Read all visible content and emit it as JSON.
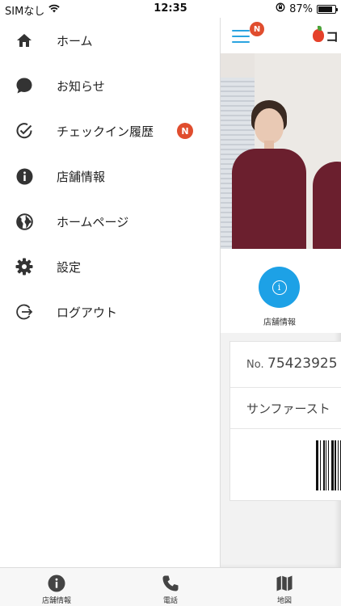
{
  "status_bar": {
    "carrier": "SIMなし",
    "time": "12:35",
    "battery": "87%",
    "battery_level": 0.87
  },
  "drawer": {
    "items": [
      {
        "label": "ホーム",
        "icon": "home-icon"
      },
      {
        "label": "お知らせ",
        "icon": "chat-bubble-icon"
      },
      {
        "label": "チェックイン履歴",
        "icon": "check-circle-icon",
        "badge": "N"
      },
      {
        "label": "店舗情報",
        "icon": "info-icon"
      },
      {
        "label": "ホームページ",
        "icon": "globe-icon"
      },
      {
        "label": "設定",
        "icon": "gear-icon"
      },
      {
        "label": "ログアウト",
        "icon": "logout-icon"
      }
    ]
  },
  "header": {
    "badge": "N",
    "logo_text": "コ"
  },
  "quick_actions": [
    {
      "label": "店舗情報",
      "icon": "info-icon"
    }
  ],
  "member_card": {
    "number_prefix": "No.",
    "number": "75423925",
    "name": "サンファースト"
  },
  "tabbar": [
    {
      "label": "店舗情報",
      "icon": "info-icon"
    },
    {
      "label": "電話",
      "icon": "phone-icon"
    },
    {
      "label": "地図",
      "icon": "map-icon"
    }
  ],
  "colors": {
    "accent": "#1da1e6",
    "badge": "#e04d2e",
    "hamburger": "#2aa4e0"
  }
}
